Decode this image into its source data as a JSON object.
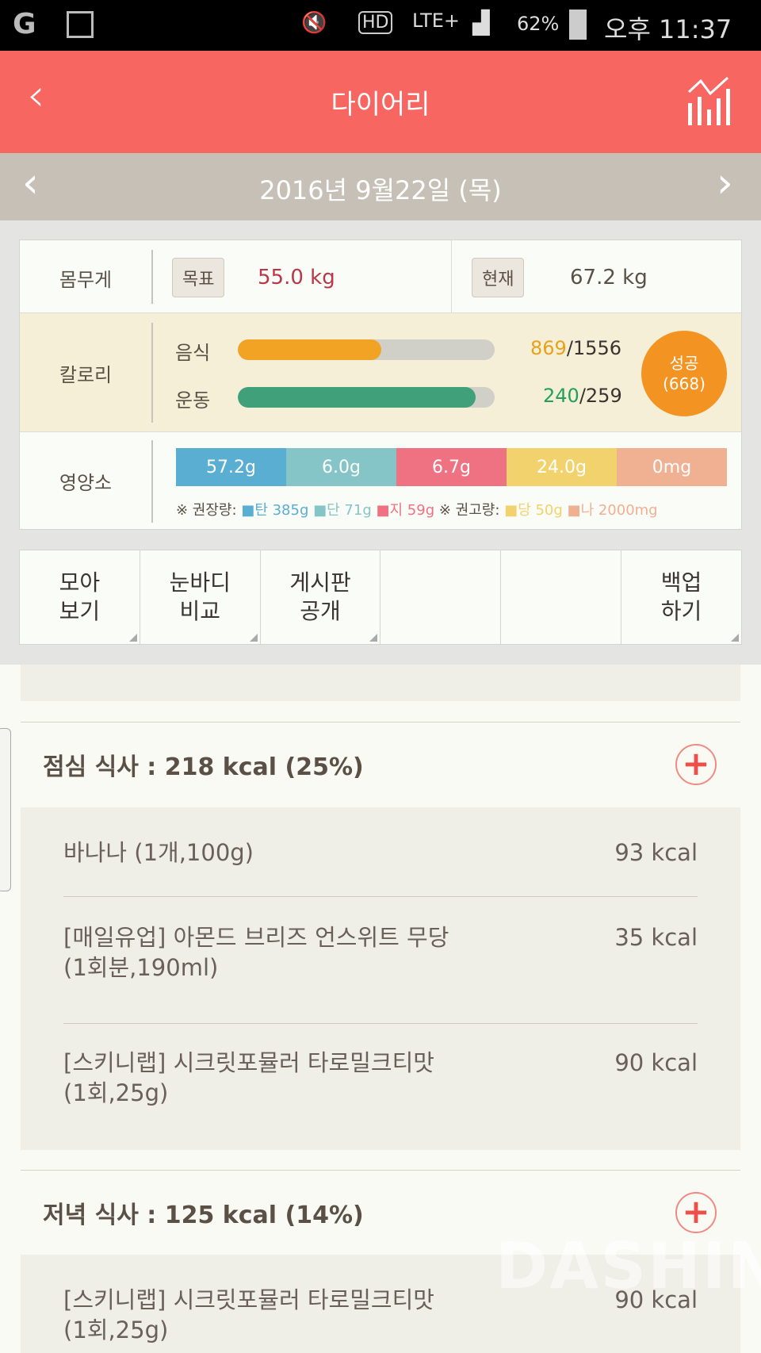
{
  "status": {
    "battery": "62%",
    "time": "오후 11:37",
    "network": "LTE+",
    "hd": "HD"
  },
  "header": {
    "title": "다이어리",
    "back_icon": "chevron-left-icon",
    "stats_icon": "chart-icon"
  },
  "date": {
    "label": "2016년 9월22일 (목)"
  },
  "weight": {
    "label": "몸무게",
    "goal_tag": "목표",
    "goal_value": "55.0 kg",
    "current_tag": "현재",
    "current_value": "67.2 kg"
  },
  "calorie": {
    "label": "칼로리",
    "food_label": "음식",
    "food_value": "869",
    "food_total": "/1556",
    "food_progress": 0.558,
    "exercise_label": "운동",
    "exercise_value": "240",
    "exercise_total": "/259",
    "exercise_progress": 0.927,
    "badge_line1": "성공",
    "badge_line2": "(668)",
    "colors": {
      "food": "#f3a323",
      "exercise": "#3fa07a",
      "badge": "#f39422"
    }
  },
  "nutrients": {
    "label": "영양소",
    "segments": [
      {
        "value": "57.2g",
        "color": "#5aaed2"
      },
      {
        "value": "6.0g",
        "color": "#85c5c8"
      },
      {
        "value": "6.7g",
        "color": "#ef7282"
      },
      {
        "value": "24.0g",
        "color": "#f2d26c"
      },
      {
        "value": "0mg",
        "color": "#f0b092"
      }
    ],
    "legend": {
      "rec_label": "※ 권장량:",
      "carb": "탄 385g",
      "protein": "단 71g",
      "fat": "지 59g",
      "limit_label": "※ 권고량:",
      "sugar": "당 50g",
      "sodium": "나 2000mg"
    }
  },
  "buttons": [
    {
      "l1": "모아",
      "l2": "보기"
    },
    {
      "l1": "눈바디",
      "l2": "비교"
    },
    {
      "l1": "게시판",
      "l2": "공개"
    },
    {
      "l1": "",
      "l2": ""
    },
    {
      "l1": "",
      "l2": ""
    },
    {
      "l1": "백업",
      "l2": "하기"
    }
  ],
  "lunch": {
    "title": "점심 식사 : 218 kcal (25%)",
    "items": [
      {
        "name": "바나나 (1개,100g)",
        "kcal": "93 kcal"
      },
      {
        "name": "[매일유업] 아몬드 브리즈 언스위트 무당",
        "name2": "(1회분,190ml)",
        "kcal": "35 kcal"
      },
      {
        "name": "[스키니랩] 시크릿포뮬러 타로밀크티맛",
        "name2": "(1회,25g)",
        "kcal": "90 kcal"
      }
    ]
  },
  "dinner": {
    "title": "저녁 식사 : 125 kcal (14%)",
    "items": [
      {
        "name": "[스키니랩] 시크릿포뮬러 타로밀크티맛",
        "name2": "(1회,25g)",
        "kcal": "90 kcal"
      }
    ]
  },
  "watermark": "DASHIN"
}
